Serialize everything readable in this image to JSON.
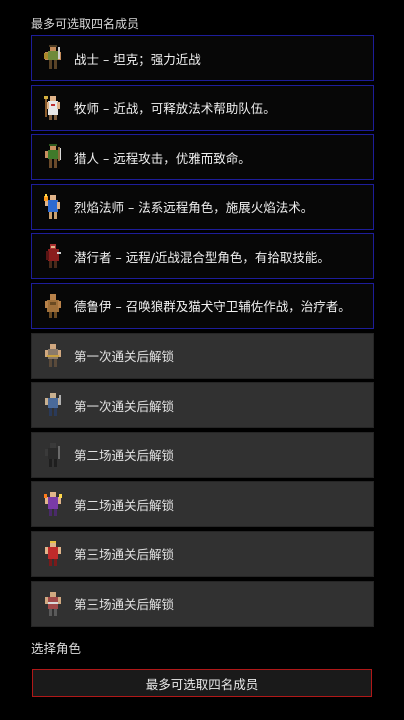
{
  "header": {
    "hint": "最多可选取四名成员"
  },
  "characters": [
    {
      "label": "战士 – 坦克；强力近战",
      "icon": "warrior-sprite-icon",
      "state": "selected"
    },
    {
      "label": "牧师 – 近战，可释放法术帮助队伍。",
      "icon": "priest-sprite-icon",
      "state": "selected"
    },
    {
      "label": "猎人 – 远程攻击，优雅而致命。",
      "icon": "hunter-sprite-icon",
      "state": "selected"
    },
    {
      "label": "烈焰法师 – 法系远程角色，施展火焰法术。",
      "icon": "fire-mage-sprite-icon",
      "state": "selected"
    },
    {
      "label": "潜行者 – 远程/近战混合型角色，有拾取技能。",
      "icon": "rogue-sprite-icon",
      "state": "selected"
    },
    {
      "label": "德鲁伊 – 召唤狼群及猫犬守卫辅佐作战，治疗者。",
      "icon": "druid-sprite-icon",
      "state": "selected"
    },
    {
      "label": "第一次通关后解锁",
      "icon": "locked-character-1-sprite-icon",
      "state": "locked"
    },
    {
      "label": "第一次通关后解锁",
      "icon": "locked-character-2-sprite-icon",
      "state": "locked"
    },
    {
      "label": "第二场通关后解锁",
      "icon": "locked-character-3-sprite-icon",
      "state": "locked"
    },
    {
      "label": "第二场通关后解锁",
      "icon": "locked-character-4-sprite-icon",
      "state": "locked"
    },
    {
      "label": "第三场通关后解锁",
      "icon": "locked-character-5-sprite-icon",
      "state": "locked"
    },
    {
      "label": "第三场通关后解锁",
      "icon": "locked-character-6-sprite-icon",
      "state": "locked"
    }
  ],
  "footer": {
    "section_label": "选择角色",
    "button_label": "最多可选取四名成员"
  },
  "colors": {
    "selected_border": "#1d1d9a",
    "locked_background": "#313131",
    "button_border": "#b01818"
  }
}
